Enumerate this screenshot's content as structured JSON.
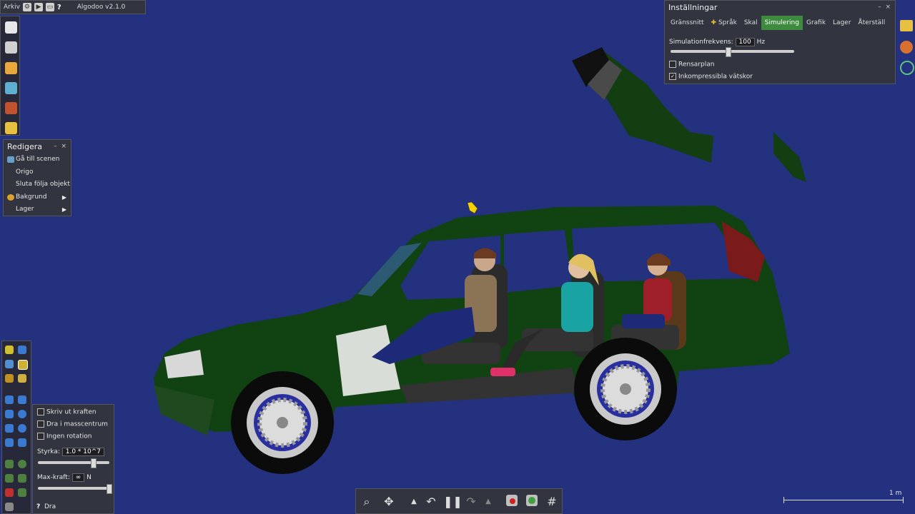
{
  "app": {
    "menu_label": "Arkiv",
    "version": "Algodoo v2.1.0"
  },
  "redigera": {
    "title": "Redigera",
    "items": [
      {
        "label": "Gå till scenen",
        "icon": "scene-icon",
        "submenu": false
      },
      {
        "label": "Origo",
        "submenu": false
      },
      {
        "label": "Sluta följa objekt",
        "submenu": false
      },
      {
        "label": "Bakgrund",
        "icon": "palette-icon",
        "submenu": true
      },
      {
        "label": "Lager",
        "submenu": true
      }
    ]
  },
  "settings": {
    "title": "Inställningar",
    "tabs": [
      "Gränssnitt",
      "Språk",
      "Skal",
      "Simulering",
      "Grafik",
      "Lager",
      "Återställ"
    ],
    "active_tab": "Simulering",
    "frequency_label": "Simulationfrekvens:",
    "frequency_value": "100",
    "frequency_unit": "Hz",
    "frequency_slider": 0.47,
    "checkboxes": [
      {
        "label": "Rensarplan",
        "checked": false
      },
      {
        "label": "Inkompressibla vätskor",
        "checked": true
      }
    ]
  },
  "tool_options": {
    "checkboxes": [
      {
        "label": "Skriv ut kraften",
        "checked": false
      },
      {
        "label": "Dra i masscentrum",
        "checked": false
      },
      {
        "label": "Ingen rotation",
        "checked": false
      }
    ],
    "strength_label": "Styrka:",
    "strength_value": "1.0 * 10^7",
    "strength_slider": 0.78,
    "maxforce_label": "Max-kraft:",
    "maxforce_value": "∞",
    "maxforce_unit": "N",
    "maxforce_slider": 1.0,
    "tool_name": "Dra"
  },
  "scale": {
    "label": "1 m"
  },
  "colors": {
    "background": "#24317f",
    "car_body": "#114211",
    "accent": "#3e8a3e"
  }
}
